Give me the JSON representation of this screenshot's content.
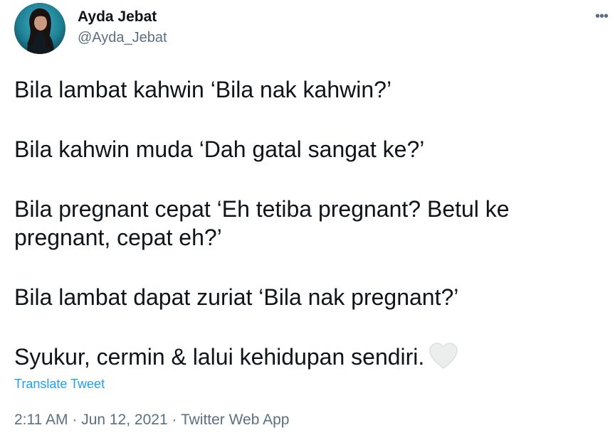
{
  "author": {
    "display_name": "Ayda Jebat",
    "handle": "@Ayda_Jebat"
  },
  "more_menu": {
    "icon": "more-horizontal-icon",
    "label": "•••"
  },
  "tweet": {
    "paragraphs": [
      "Bila lambat kahwin ‘Bila nak kahwin?’",
      "Bila kahwin muda ‘Dah gatal sangat ke?’",
      "Bila pregnant cepat ‘Eh tetiba pregnant? Betul ke pregnant, cepat eh?’",
      "Bila lambat dapat zuriat ‘Bila nak pregnant?’",
      "Syukur, cermin & lalui kehidupan sendiri."
    ],
    "emoji": "white-heart-icon"
  },
  "translate_label": "Translate Tweet",
  "meta": {
    "time": "2:11 AM",
    "separator": "·",
    "date": "Jun 12, 2021",
    "source": "Twitter Web App"
  },
  "colors": {
    "text": "#0f1419",
    "secondary": "#5b7083",
    "link": "#1da1f2"
  }
}
